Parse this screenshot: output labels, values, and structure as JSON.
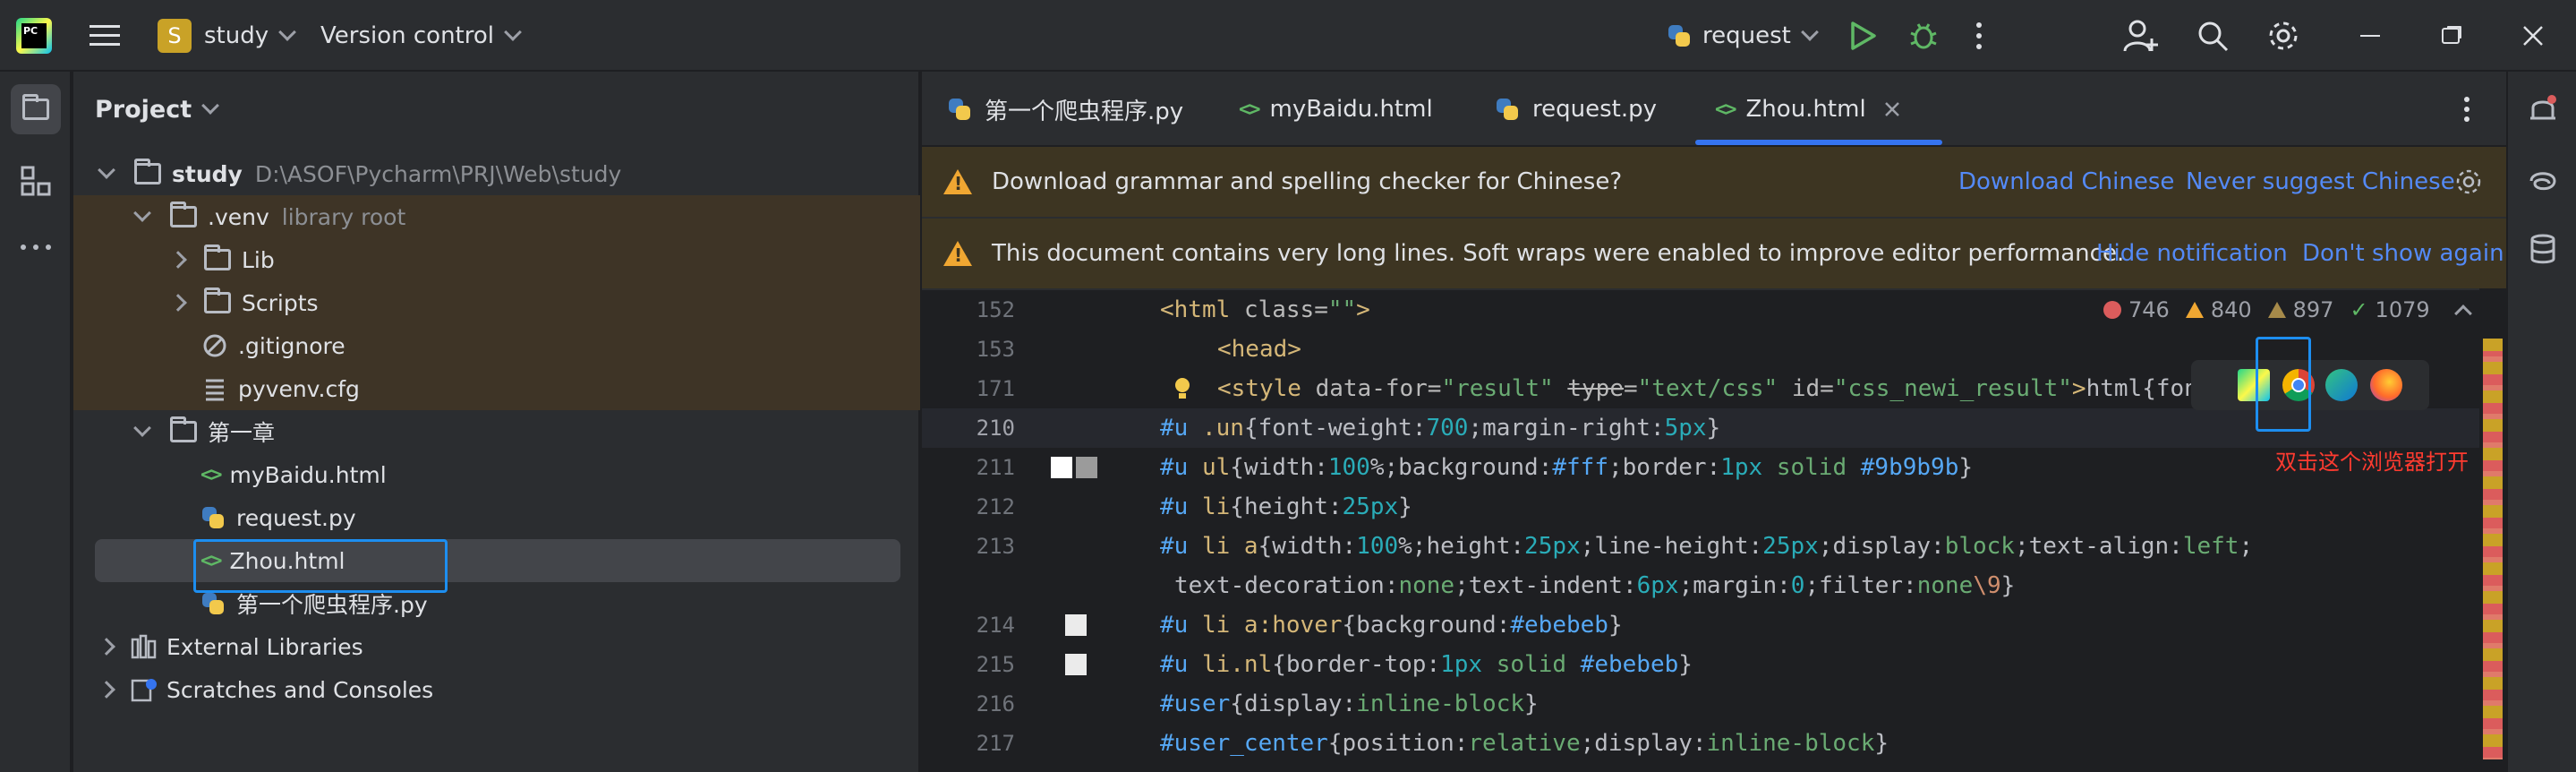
{
  "titlebar": {
    "project_badge": "S",
    "project_name": "study",
    "vcs_label": "Version control",
    "run_config": "request"
  },
  "project_panel": {
    "title": "Project",
    "tree": [
      {
        "label": "study",
        "note": "D:\\ASOF\\Pycharm\\PRJ\\Web\\study",
        "kind": "folder",
        "expanded": true
      },
      {
        "label": ".venv",
        "note": "library root",
        "kind": "folder",
        "expanded": true
      },
      {
        "label": "Lib",
        "kind": "folder",
        "expanded": false
      },
      {
        "label": "Scripts",
        "kind": "folder",
        "expanded": false
      },
      {
        "label": ".gitignore",
        "kind": "ignore-file"
      },
      {
        "label": "pyvenv.cfg",
        "kind": "config-file"
      },
      {
        "label": "第一章",
        "kind": "folder",
        "expanded": true
      },
      {
        "label": "myBaidu.html",
        "kind": "html-file"
      },
      {
        "label": "request.py",
        "kind": "python-file"
      },
      {
        "label": "Zhou.html",
        "kind": "html-file",
        "selected": true
      },
      {
        "label": "第一个爬虫程序.py",
        "kind": "python-file"
      },
      {
        "label": "External Libraries",
        "kind": "library"
      },
      {
        "label": "Scratches and Consoles",
        "kind": "scratch"
      }
    ]
  },
  "tabs": [
    {
      "label": "第一个爬虫程序.py",
      "icon": "python-file-icon"
    },
    {
      "label": "myBaidu.html",
      "icon": "html-file-icon"
    },
    {
      "label": "request.py",
      "icon": "python-file-icon"
    },
    {
      "label": "Zhou.html",
      "icon": "html-file-icon",
      "active": true
    }
  ],
  "banners": {
    "grammar": {
      "message": "Download grammar and spelling checker for Chinese?",
      "action1": "Download Chinese",
      "action2": "Never suggest Chinese"
    },
    "long_lines": {
      "message": "This document contains very long lines. Soft wraps were enabled to improve editor performance.",
      "action1": "Hide notification",
      "action2": "Don't show again"
    }
  },
  "inspections": {
    "errors": "746",
    "warnings": "840",
    "weak_warnings": "897",
    "ok": "1079"
  },
  "gutter_lines": [
    "152",
    "153",
    "171",
    "210",
    "211",
    "212",
    "213",
    "",
    "214",
    "215",
    "216",
    "217"
  ],
  "browser_popup": {
    "annotation": "双击这个浏览器打开"
  },
  "colors": {
    "accent": "#3574f0",
    "highlight_box": "#1d8ef0",
    "annotation": "#ff3b30",
    "banner_bg": "#3d3522",
    "venv_bg": "#3e3426"
  }
}
